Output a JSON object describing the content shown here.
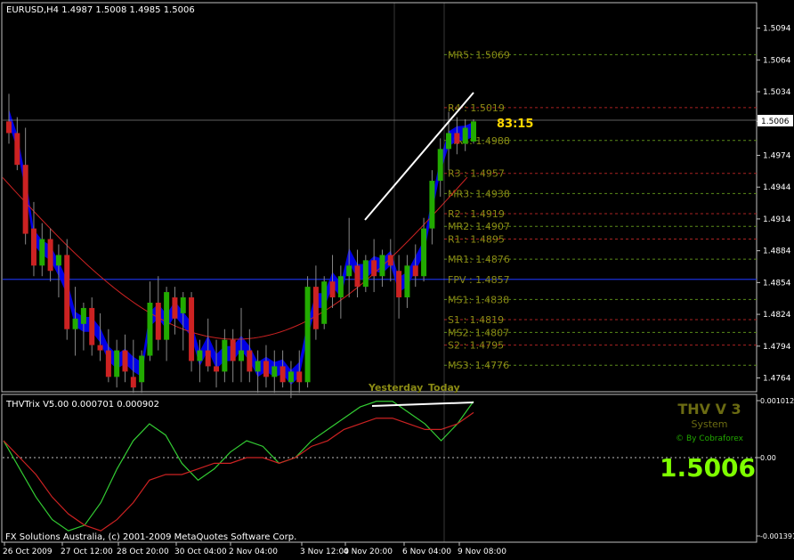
{
  "window": {
    "title": "EURUSD,H4  1.4987 1.5008 1.4985 1.5006",
    "indicator_title": "THVTrix V5.00 0.000701 0.000902",
    "copyright": "FX Solutions Australia, (c) 2001-2009 MetaQuotes Software Corp.",
    "countdown": "83:15",
    "current_price_tag": "1.5006",
    "day_labels": [
      "Yesterday",
      "Today"
    ],
    "branding": {
      "name": "THV V 3",
      "sub": "System",
      "author": "© By Cobraforex",
      "price": "1.5006"
    }
  },
  "colors": {
    "background": "#000000",
    "grid": "#c0c0c0",
    "bull": "#22aa00",
    "bear": "#cc2222",
    "cloud": "#0000ff",
    "level_text": "#8a8a14",
    "level_line_green": "#5a8a1a",
    "level_line_red": "#aa2222",
    "countdown": "#ffd700",
    "big_price": "#7fff00",
    "trix_fast": "#33cc33",
    "trix_slow": "#cc2222"
  },
  "chart_data": [
    {
      "type": "candlestick",
      "title": "EURUSD,H4",
      "ohlc_header": [
        1.4987,
        1.5008,
        1.4985,
        1.5006
      ],
      "ylim": [
        1.4751,
        1.5118
      ],
      "y_ticks": [
        "1.5094",
        "1.5064",
        "1.5034",
        "1.5006",
        "1.4974",
        "1.4944",
        "1.4914",
        "1.4884",
        "1.4854",
        "1.4824",
        "1.4794",
        "1.4764"
      ],
      "x_ticks": [
        "26 Oct 2009",
        "27 Oct 12:00",
        "28 Oct 20:00",
        "30 Oct 04:00",
        "2 Nov 04:00",
        "3 Nov 12:00",
        "4 Nov 20:00",
        "6 Nov 04:00",
        "9 Nov 08:00"
      ],
      "current_price": 1.5006,
      "levels": [
        {
          "label": "MR5: 1.5069",
          "value": 1.5069,
          "kind": "mr"
        },
        {
          "label": "R4 : 1.5019",
          "value": 1.5019,
          "kind": "r"
        },
        {
          "label": "MR4: 1.4988",
          "value": 1.4988,
          "kind": "mr"
        },
        {
          "label": "R3 : 1.4957",
          "value": 1.4957,
          "kind": "r"
        },
        {
          "label": "MR3: 1.4938",
          "value": 1.4938,
          "kind": "mr"
        },
        {
          "label": "R2 : 1.4919",
          "value": 1.4919,
          "kind": "r"
        },
        {
          "label": "MR2: 1.4907",
          "value": 1.4907,
          "kind": "mr"
        },
        {
          "label": "R1 : 1.4895",
          "value": 1.4895,
          "kind": "r"
        },
        {
          "label": "MR1: 1.4876",
          "value": 1.4876,
          "kind": "mr"
        },
        {
          "label": "FPV : 1.4857",
          "value": 1.4857,
          "kind": "pv"
        },
        {
          "label": "MS1: 1.4838",
          "value": 1.4838,
          "kind": "mr"
        },
        {
          "label": "S1 : 1.4819",
          "value": 1.4819,
          "kind": "s"
        },
        {
          "label": "MS2: 1.4807",
          "value": 1.4807,
          "kind": "mr"
        },
        {
          "label": "S2 : 1.4795",
          "value": 1.4795,
          "kind": "s"
        },
        {
          "label": "MS3: 1.4776",
          "value": 1.4776,
          "kind": "mr"
        }
      ],
      "candles": [
        [
          1.5006,
          1.5032,
          1.4985,
          1.4995
        ],
        [
          1.4995,
          1.501,
          1.496,
          1.4965
        ],
        [
          1.4965,
          1.5,
          1.489,
          1.49
        ],
        [
          1.4905,
          1.493,
          1.486,
          1.487
        ],
        [
          1.487,
          1.491,
          1.486,
          1.4895
        ],
        [
          1.4895,
          1.4905,
          1.4855,
          1.4865
        ],
        [
          1.487,
          1.489,
          1.484,
          1.488
        ],
        [
          1.488,
          1.4895,
          1.48,
          1.481
        ],
        [
          1.481,
          1.485,
          1.4785,
          1.482
        ],
        [
          1.4815,
          1.4835,
          1.479,
          1.483
        ],
        [
          1.483,
          1.484,
          1.4785,
          1.4795
        ],
        [
          1.4795,
          1.4825,
          1.478,
          1.479
        ],
        [
          1.479,
          1.481,
          1.476,
          1.4765
        ],
        [
          1.4765,
          1.48,
          1.4755,
          1.479
        ],
        [
          1.479,
          1.4805,
          1.476,
          1.477
        ],
        [
          1.4765,
          1.48,
          1.475,
          1.4755
        ],
        [
          1.476,
          1.479,
          1.475,
          1.4785
        ],
        [
          1.4785,
          1.4855,
          1.478,
          1.4835
        ],
        [
          1.4835,
          1.486,
          1.479,
          1.48
        ],
        [
          1.48,
          1.485,
          1.478,
          1.4845
        ],
        [
          1.484,
          1.485,
          1.4805,
          1.482
        ],
        [
          1.4825,
          1.4845,
          1.479,
          1.484
        ],
        [
          1.484,
          1.4845,
          1.477,
          1.478
        ],
        [
          1.478,
          1.48,
          1.476,
          1.479
        ],
        [
          1.479,
          1.482,
          1.477,
          1.4775
        ],
        [
          1.4775,
          1.48,
          1.4755,
          1.477
        ],
        [
          1.477,
          1.481,
          1.476,
          1.48
        ],
        [
          1.48,
          1.481,
          1.476,
          1.478
        ],
        [
          1.478,
          1.483,
          1.476,
          1.479
        ],
        [
          1.479,
          1.481,
          1.476,
          1.477
        ],
        [
          1.477,
          1.479,
          1.475,
          1.478
        ],
        [
          1.478,
          1.4795,
          1.4755,
          1.4765
        ],
        [
          1.4765,
          1.479,
          1.475,
          1.4775
        ],
        [
          1.4775,
          1.479,
          1.4755,
          1.476
        ],
        [
          1.476,
          1.478,
          1.4745,
          1.477
        ],
        [
          1.477,
          1.479,
          1.475,
          1.476
        ],
        [
          1.476,
          1.486,
          1.4755,
          1.485
        ],
        [
          1.485,
          1.487,
          1.48,
          1.481
        ],
        [
          1.4815,
          1.486,
          1.481,
          1.4855
        ],
        [
          1.4855,
          1.488,
          1.483,
          1.484
        ],
        [
          1.484,
          1.487,
          1.482,
          1.486
        ],
        [
          1.486,
          1.4915,
          1.484,
          1.487
        ],
        [
          1.487,
          1.4885,
          1.484,
          1.485
        ],
        [
          1.485,
          1.488,
          1.4845,
          1.4875
        ],
        [
          1.4875,
          1.4895,
          1.4845,
          1.486
        ],
        [
          1.486,
          1.4885,
          1.485,
          1.488
        ],
        [
          1.488,
          1.4895,
          1.4855,
          1.487
        ],
        [
          1.4865,
          1.488,
          1.482,
          1.484
        ],
        [
          1.484,
          1.488,
          1.483,
          1.487
        ],
        [
          1.487,
          1.489,
          1.485,
          1.486
        ],
        [
          1.486,
          1.4915,
          1.4855,
          1.4905
        ],
        [
          1.4905,
          1.496,
          1.489,
          1.495
        ],
        [
          1.495,
          1.499,
          1.4935,
          1.498
        ],
        [
          1.498,
          1.5015,
          1.496,
          1.4995
        ],
        [
          1.4995,
          1.501,
          1.4975,
          1.4985
        ],
        [
          1.4985,
          1.5008,
          1.4978,
          1.5
        ],
        [
          1.4987,
          1.5008,
          1.4985,
          1.5006
        ]
      ]
    },
    {
      "type": "line",
      "title": "THVTrix V5.00",
      "values_header": [
        0.000701,
        0.000902
      ],
      "ylim": [
        -0.001391,
        0.001012
      ],
      "y_ticks": [
        "0.001012",
        "0.00",
        "-0.001391"
      ],
      "series": [
        {
          "values": [
            0.0003,
            -0.0002,
            -0.0007,
            -0.0011,
            -0.0013,
            -0.0012,
            -0.0008,
            -0.0002,
            0.0003,
            0.0006,
            0.0004,
            -0.0001,
            -0.0004,
            -0.0002,
            0.0001,
            0.0003,
            0.0002,
            -0.0001,
            0.0,
            0.0003,
            0.0005,
            0.0007,
            0.0009,
            0.001,
            0.001,
            0.0008,
            0.0006,
            0.0003,
            0.0006,
            0.001
          ]
        },
        {
          "values": [
            0.0003,
            0.0,
            -0.0003,
            -0.0007,
            -0.001,
            -0.0012,
            -0.0013,
            -0.0011,
            -0.0008,
            -0.0004,
            -0.0003,
            -0.0003,
            -0.0002,
            -0.0001,
            -0.0001,
            0.0,
            0.0,
            -0.0001,
            0.0,
            0.0002,
            0.0003,
            0.0005,
            0.0006,
            0.0007,
            0.0007,
            0.0006,
            0.0005,
            0.0005,
            0.0006,
            0.0008
          ]
        }
      ]
    }
  ]
}
